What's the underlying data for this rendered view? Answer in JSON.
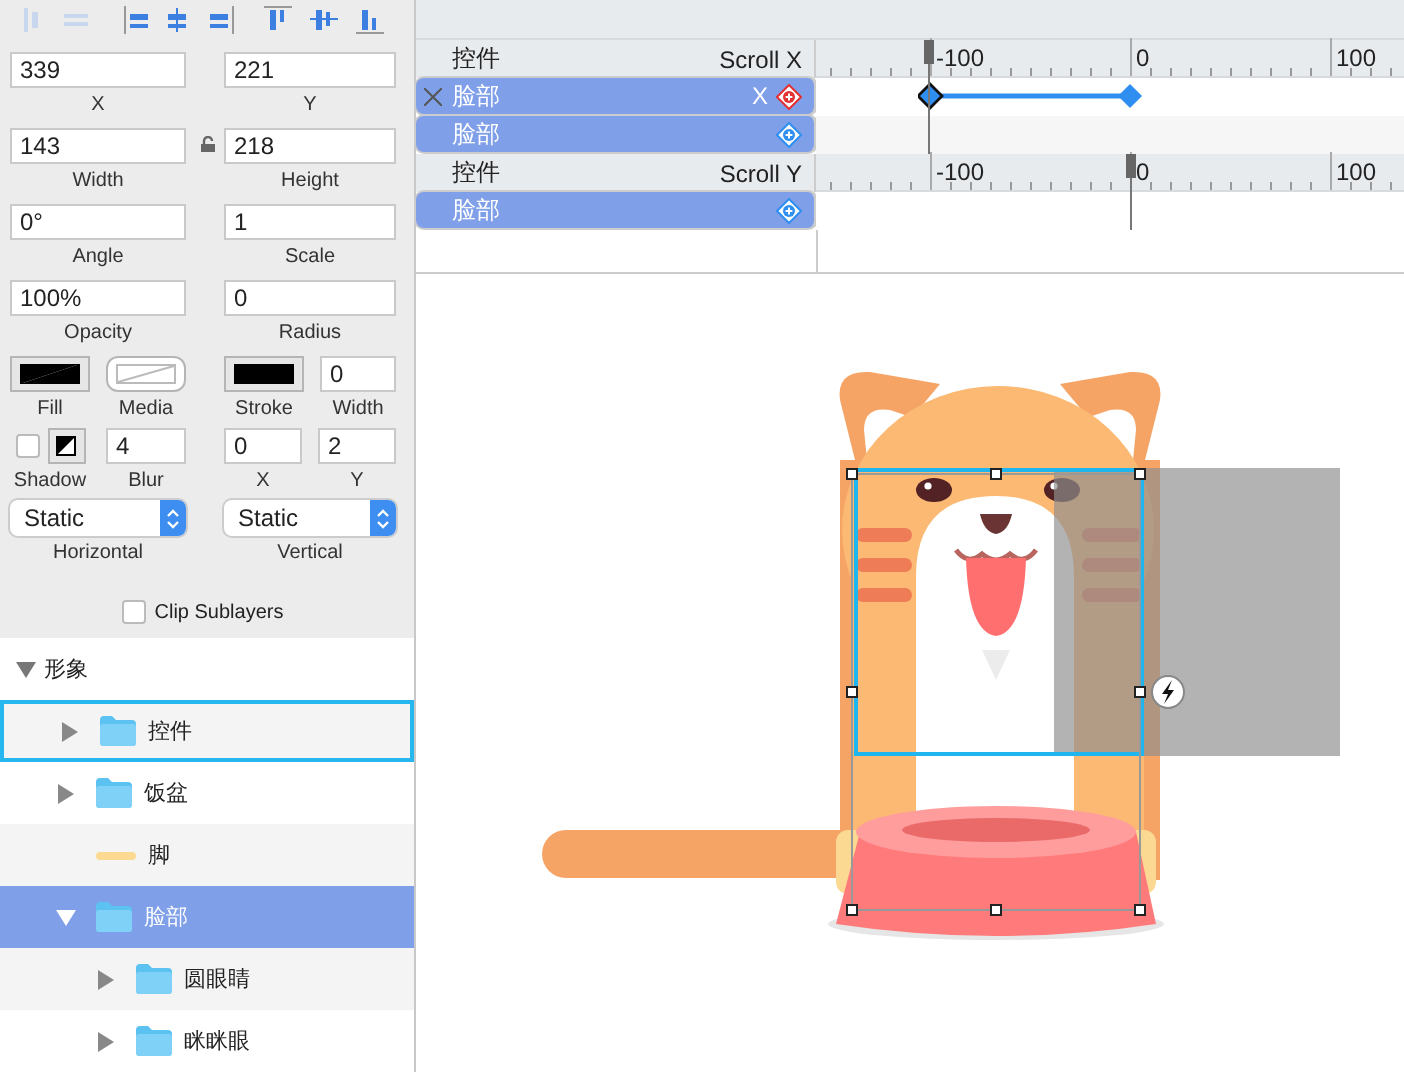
{
  "inspector": {
    "rows": [
      {
        "lock": false,
        "halves": [
          [
            {
              "kind": "field",
              "value": "339",
              "label": "X"
            }
          ],
          [
            {
              "kind": "field",
              "value": "221",
              "label": "Y"
            }
          ]
        ]
      },
      {
        "lock": true,
        "halves": [
          [
            {
              "kind": "field",
              "value": "143",
              "label": "Width"
            }
          ],
          [
            {
              "kind": "field",
              "value": "218",
              "label": "Height"
            }
          ]
        ]
      },
      {
        "lock": false,
        "halves": [
          [
            {
              "kind": "field",
              "value": "0°",
              "label": "Angle"
            }
          ],
          [
            {
              "kind": "field",
              "value": "1",
              "label": "Scale"
            }
          ]
        ]
      },
      {
        "lock": false,
        "halves": [
          [
            {
              "kind": "field",
              "value": "100%",
              "label": "Opacity"
            }
          ],
          [
            {
              "kind": "field",
              "value": "0",
              "label": "Radius"
            }
          ]
        ]
      },
      {
        "lock": false,
        "halves": [
          [
            {
              "kind": "fill",
              "label": "Fill"
            },
            {
              "kind": "media",
              "label": "Media"
            }
          ],
          [
            {
              "kind": "stroke",
              "label": "Stroke"
            },
            {
              "kind": "field",
              "value": "0",
              "label": "Width"
            }
          ]
        ]
      },
      {
        "lock": false,
        "halves": [
          [
            {
              "kind": "shadow",
              "label": "Shadow",
              "checked": false
            },
            {
              "kind": "field",
              "value": "4",
              "label": "Blur"
            }
          ],
          [
            {
              "kind": "field",
              "value": "0",
              "label": "X"
            },
            {
              "kind": "field",
              "value": "2",
              "label": "Y"
            }
          ]
        ]
      },
      {
        "lock": false,
        "halves": [
          [
            {
              "kind": "select",
              "value": "Static",
              "label": "Horizontal"
            }
          ],
          [
            {
              "kind": "select",
              "value": "Static",
              "label": "Vertical"
            }
          ]
        ]
      }
    ],
    "clip": {
      "label": "Clip Sublayers",
      "checked": false
    }
  },
  "layers": [
    {
      "label": "形象",
      "expanded": true,
      "selected": false,
      "focused": false,
      "children": [
        {
          "label": "控件",
          "kind": "folder",
          "expanded": false,
          "selected": false,
          "focused": true
        },
        {
          "label": "饭盆",
          "kind": "folder",
          "expanded": false,
          "selected": false,
          "focused": false
        },
        {
          "label": "脚",
          "kind": "shape",
          "selected": false,
          "focused": false
        },
        {
          "label": "脸部",
          "kind": "folder",
          "expanded": true,
          "selected": true,
          "focused": false,
          "children": [
            {
              "label": "圆眼睛",
              "kind": "folder",
              "expanded": false,
              "selected": false,
              "focused": false
            },
            {
              "label": "眯眯眼",
              "kind": "folder",
              "expanded": false,
              "selected": false,
              "focused": false
            }
          ]
        }
      ]
    }
  ],
  "timeline": {
    "groups": [
      {
        "label": "控件",
        "property": "Scroll X",
        "ticks": [
          "-100",
          "0",
          "100"
        ],
        "playhead": {
          "level": 0.19
        },
        "rows": [
          {
            "kind": "animated",
            "label": "脸部",
            "property": "X"
          },
          {
            "kind": "plain",
            "label": "脸部"
          }
        ]
      },
      {
        "label": "控件",
        "property": "Scroll Y",
        "ticks": [
          "-100",
          "0",
          "100"
        ],
        "playhead": {
          "level": 0.535
        },
        "rows": [
          {
            "kind": "plain",
            "label": "脸部"
          }
        ]
      }
    ]
  }
}
